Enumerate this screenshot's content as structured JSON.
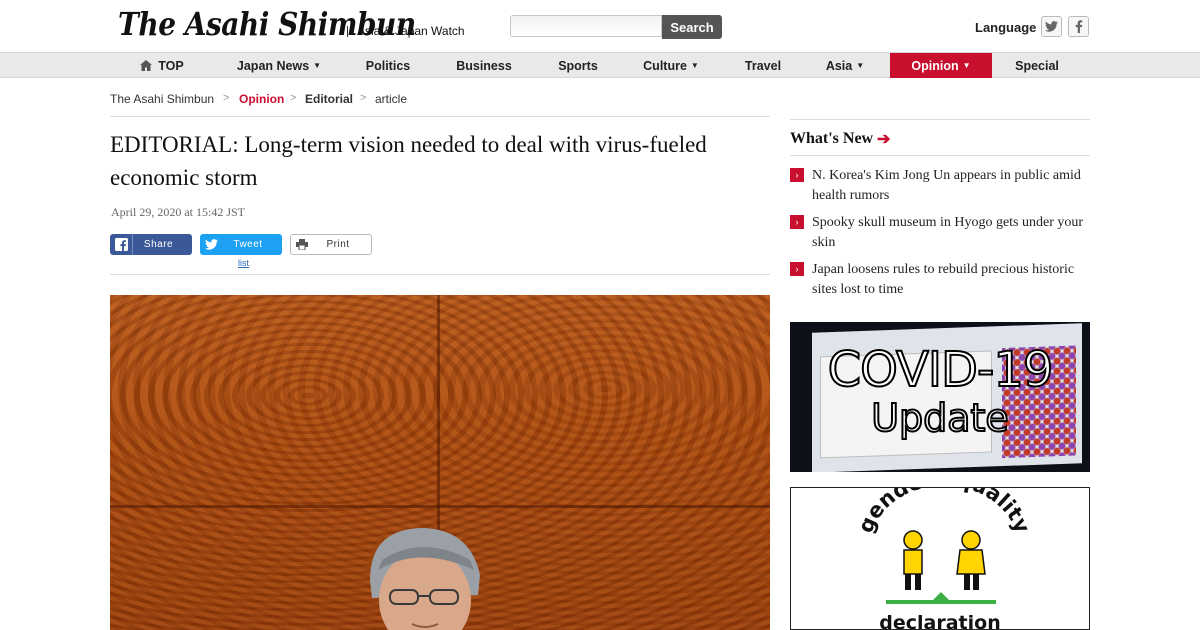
{
  "header": {
    "logo": "The Asahi Shimbun",
    "tagline": "Asia & Japan Watch",
    "search_placeholder": "",
    "search_button": "Search",
    "language_label": "Language"
  },
  "nav": {
    "items": [
      {
        "label": "TOP"
      },
      {
        "label": "Japan News"
      },
      {
        "label": "Politics"
      },
      {
        "label": "Business"
      },
      {
        "label": "Sports"
      },
      {
        "label": "Culture"
      },
      {
        "label": "Travel"
      },
      {
        "label": "Asia"
      },
      {
        "label": "Opinion"
      },
      {
        "label": "Special"
      }
    ],
    "active": "Opinion"
  },
  "breadcrumb": [
    "The Asahi Shimbun",
    "Opinion",
    "Editorial",
    "article"
  ],
  "article": {
    "headline": "EDITORIAL: Long-term vision needed to deal with virus-fueled economic storm",
    "date": "April 29, 2020 at 15:42 JST",
    "share_label": "Share",
    "tweet_label": "Tweet",
    "print_label": "Print",
    "list_label": "list"
  },
  "sidebar": {
    "whats_new": "What's New",
    "items": [
      {
        "text": "N. Korea's Kim Jong Un appears in public amid health rumors"
      },
      {
        "text": "Spooky skull museum in Hyogo gets under your skin"
      },
      {
        "text": "Japan loosens rules to rebuild precious historic sites lost to time"
      }
    ],
    "covid_banner": {
      "line1": "COVID-19",
      "line2": "Update"
    },
    "gender_banner": {
      "top": "gender equality",
      "bottom": "declaration"
    }
  },
  "colors": {
    "accent": "#c8102e",
    "facebook": "#3b5998",
    "twitter": "#1da1f2"
  }
}
